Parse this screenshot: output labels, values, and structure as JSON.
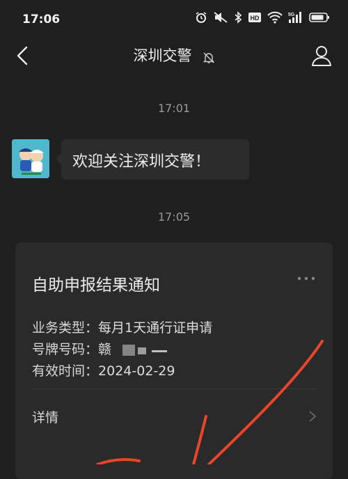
{
  "status_bar": {
    "time": "17:06",
    "icons": [
      "alarm-icon",
      "mute-icon",
      "bluetooth-icon",
      "hd-icon",
      "wifi-icon",
      "signal-5g-icon",
      "battery-icon"
    ],
    "hd_label": "HD",
    "net_label": "5G"
  },
  "nav": {
    "title": "深圳交警"
  },
  "messages": {
    "ts1": "17:01",
    "welcome": "欢迎关注深圳交警！",
    "ts2": "17:05"
  },
  "card": {
    "title": "自助申报结果通知",
    "rows": [
      {
        "label": "业务类型：",
        "value": "每月1天通行证申请"
      },
      {
        "label": "号牌号码：",
        "value": "赣"
      },
      {
        "label": "有效时间：",
        "value": "2024-02-29"
      }
    ],
    "details_label": "详情"
  },
  "colors": {
    "background": "#1f1f1f",
    "card": "#2a2a2a",
    "annotation_red": "#e8452a"
  }
}
